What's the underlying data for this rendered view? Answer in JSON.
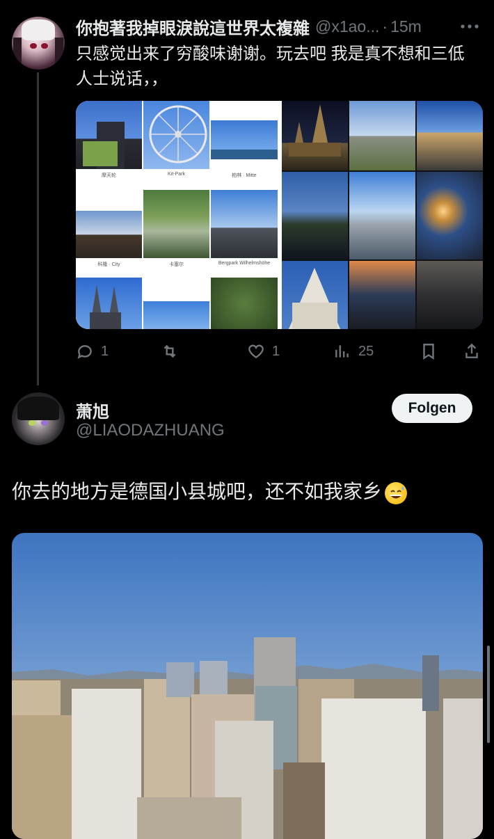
{
  "tweet1": {
    "display_name": "你抱著我掉眼淚說這世界太複雜",
    "handle": "@x1ao...",
    "separator": "·",
    "time": "15m",
    "more_icon": "ellipsis-icon",
    "text": "只感觉出来了穷酸味谢谢。玩去吧 我是真不想和三低人士说话，，",
    "media_labels": [
      "摩天轮",
      "Kit-Park",
      "柏林 · Mitte",
      "科隆 · City",
      "卡塞尔",
      "Bergpark Wilhelmshöhe"
    ],
    "actions": {
      "reply_count": "1",
      "retweet_count": "",
      "like_count": "1",
      "view_count": "25"
    }
  },
  "tweet2": {
    "display_name": "萧旭",
    "handle": "@LIAODAZHUANG",
    "follow_label": "Folgen",
    "text": "你去的地方是德国小县城吧，还不如我家乡"
  },
  "colors": {
    "background": "#000000",
    "text_primary": "#e7e9ea",
    "text_secondary": "#71767b",
    "follow_bg": "#eff3f4"
  }
}
